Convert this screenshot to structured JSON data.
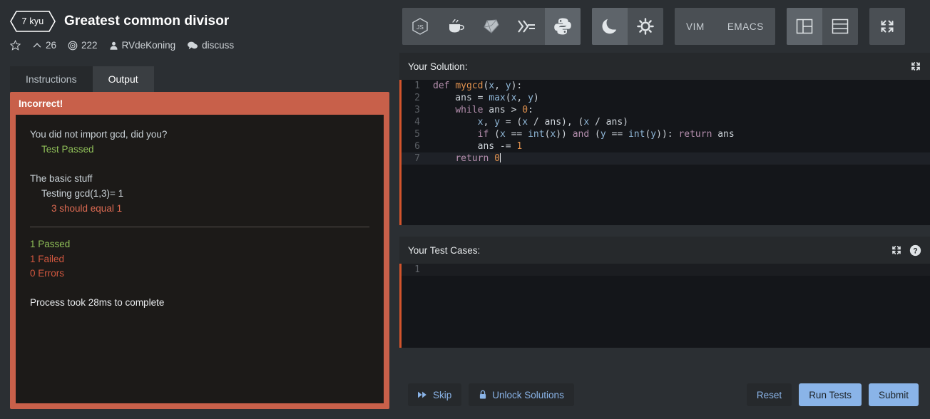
{
  "kata": {
    "rank": "7 kyu",
    "title": "Greatest common divisor",
    "stats": {
      "star_icon": "star-icon",
      "upvote_icon": "chevron-up-icon",
      "upvotes": "26",
      "completed_icon": "target-icon",
      "completed": "222",
      "author_icon": "person-icon",
      "author": "RVdeKoning",
      "discuss_icon": "speech-bubble-icon",
      "discuss": "discuss"
    }
  },
  "tabs": [
    {
      "label": "Instructions",
      "active": false
    },
    {
      "label": "Output",
      "active": true
    }
  ],
  "output": {
    "status": "Incorrect!",
    "lines": [
      {
        "text": "You did not import gcd, did you?",
        "style": "group",
        "indent": 0
      },
      {
        "text": "Test Passed",
        "style": "pass",
        "indent": 1
      },
      {
        "text": "",
        "style": "gap",
        "indent": 0
      },
      {
        "text": "The basic stuff",
        "style": "group",
        "indent": 0
      },
      {
        "text": "Testing gcd(1,3)= 1",
        "style": "group",
        "indent": 1
      },
      {
        "text": "3 should equal 1",
        "style": "fail-soft",
        "indent": 2
      }
    ],
    "summary": {
      "passed": "1 Passed",
      "failed": "1 Failed",
      "errors": "0 Errors",
      "process": "Process took 28ms to complete"
    }
  },
  "toolbar": {
    "languages": [
      {
        "name": "nodejs-icon",
        "label": "JS",
        "selected": false
      },
      {
        "name": "java-icon",
        "label": "Java",
        "selected": false
      },
      {
        "name": "ruby-icon",
        "label": "Ruby",
        "selected": false
      },
      {
        "name": "haskell-icon",
        "label": "Haskell",
        "selected": false
      },
      {
        "name": "python-icon",
        "label": "Python",
        "selected": true
      }
    ],
    "themes": [
      {
        "name": "moon-icon",
        "label": "Dark theme",
        "selected": true
      },
      {
        "name": "sun-icon",
        "label": "Light theme",
        "selected": false
      }
    ],
    "keybindings": [
      {
        "label": "VIM",
        "selected": false
      },
      {
        "label": "EMACS",
        "selected": false
      }
    ],
    "layouts": [
      {
        "name": "layout-vertical-split-icon",
        "selected": true
      },
      {
        "name": "layout-horizontal-split-icon",
        "selected": false
      }
    ],
    "fullscreen": {
      "name": "fullscreen-icon"
    }
  },
  "solution": {
    "header": "Your Solution:",
    "expand_icon": "expand-icon",
    "code_lines": [
      {
        "n": "1",
        "active": false
      },
      {
        "n": "2",
        "active": false
      },
      {
        "n": "3",
        "active": false
      },
      {
        "n": "4",
        "active": false
      },
      {
        "n": "5",
        "active": false
      },
      {
        "n": "6",
        "active": false
      },
      {
        "n": "7",
        "active": true
      }
    ],
    "code_text": [
      "def mygcd(x, y):",
      "    ans = max(x, y)",
      "    while ans > 0:",
      "        x, y = (x / ans), (x / ans)",
      "        if (x == int(x)) and (y == int(y)): return ans",
      "        ans -= 1",
      "    return 0"
    ]
  },
  "testcases": {
    "header": "Your Test Cases:",
    "expand_icon": "expand-icon",
    "help_icon": "help-icon",
    "line_numbers": [
      "1"
    ],
    "content": ""
  },
  "actions": {
    "skip": {
      "label": "Skip",
      "icon": "fast-forward-icon"
    },
    "unlock": {
      "label": "Unlock Solutions",
      "icon": "lock-icon"
    },
    "reset": {
      "label": "Reset"
    },
    "run": {
      "label": "Run Tests"
    },
    "submit": {
      "label": "Submit"
    }
  },
  "colors": {
    "accent_red": "#c8604a",
    "accent_blue": "#8ab4e8",
    "pass_green": "#8fbf58",
    "fail_red": "#d2573f",
    "editor_stripe": "#d2542c"
  }
}
